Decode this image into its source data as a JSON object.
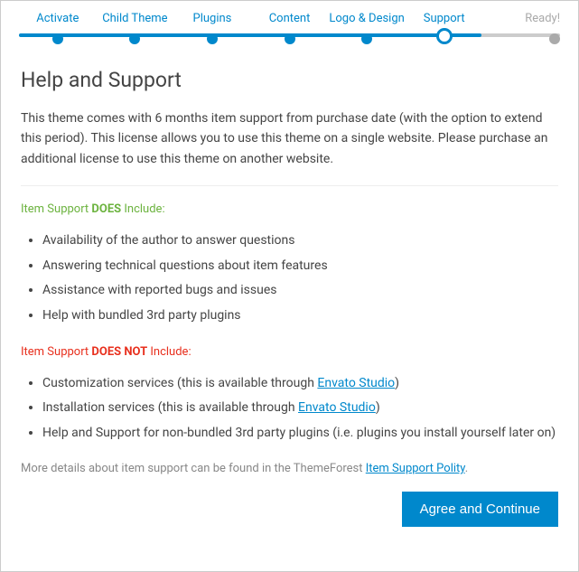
{
  "stepper": {
    "steps": [
      {
        "label": "Activate",
        "state": "done"
      },
      {
        "label": "Child Theme",
        "state": "done"
      },
      {
        "label": "Plugins",
        "state": "done"
      },
      {
        "label": "Content",
        "state": "done"
      },
      {
        "label": "Logo & Design",
        "state": "done"
      },
      {
        "label": "Support",
        "state": "current"
      },
      {
        "label": "Ready!",
        "state": "upcoming"
      }
    ],
    "progress_percent": 83
  },
  "page": {
    "title": "Help and Support",
    "intro": "This theme comes with 6 months item support from purchase date (with the option to extend this period). This license allows you to use this theme on a single website. Please purchase an additional license to use this theme on another website."
  },
  "includes": {
    "heading_pre": "Item Support ",
    "heading_strong": "DOES",
    "heading_post": " Include:",
    "items": [
      "Availability of the author to answer questions",
      "Answering technical questions about item features",
      "Assistance with reported bugs and issues",
      "Help with bundled 3rd party plugins"
    ]
  },
  "excludes": {
    "heading_pre": "Item Support ",
    "heading_strong": "DOES NOT",
    "heading_post": " Include:",
    "items": [
      {
        "pre": "Customization services (this is available through ",
        "link": "Envato Studio",
        "post": ")"
      },
      {
        "pre": "Installation services (this is available through ",
        "link": "Envato Studio",
        "post": ")"
      },
      {
        "pre": "Help and Support for non-bundled 3rd party plugins (i.e. plugins you install yourself later on)",
        "link": "",
        "post": ""
      }
    ]
  },
  "footnote": {
    "pre": "More details about item support can be found in the ThemeForest ",
    "link": "Item Support Polity",
    "post": "."
  },
  "actions": {
    "continue": "Agree and Continue"
  }
}
